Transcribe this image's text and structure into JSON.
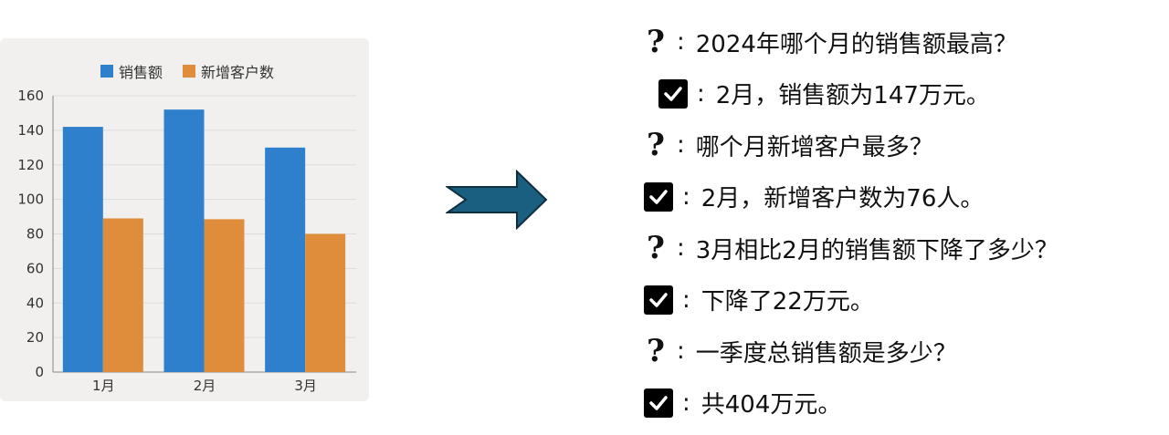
{
  "chart_data": {
    "type": "bar",
    "categories": [
      "1月",
      "2月",
      "3月"
    ],
    "series": [
      {
        "name": "销售额",
        "values": [
          142,
          152,
          130
        ],
        "color": "#2f80cc"
      },
      {
        "name": "新增客户数",
        "values": [
          89,
          88.5,
          80
        ],
        "color": "#df8c3b"
      }
    ],
    "ylim": [
      0,
      160
    ],
    "yticks": [
      0,
      20,
      40,
      60,
      80,
      100,
      120,
      140,
      160
    ],
    "grid": true,
    "legend": "top-center"
  },
  "arrow_color": "#1a5e80",
  "qa": [
    {
      "type": "question",
      "text": "2024年哪个月的销售额最高？"
    },
    {
      "type": "answer",
      "text": "2月，销售额为147万元。"
    },
    {
      "type": "question",
      "text": "哪个月新增客户最多？"
    },
    {
      "type": "answer",
      "text": "2月，新增客户数为76人。"
    },
    {
      "type": "question",
      "text": "3月相比2月的销售额下降了多少？"
    },
    {
      "type": "answer",
      "text": "下降了22万元。"
    },
    {
      "type": "question",
      "text": "一季度总销售额是多少？"
    },
    {
      "type": "answer",
      "text": "共404万元。"
    }
  ],
  "colon": ":",
  "icons": {
    "question": "question-mark-icon",
    "answer": "checkmark-icon"
  }
}
